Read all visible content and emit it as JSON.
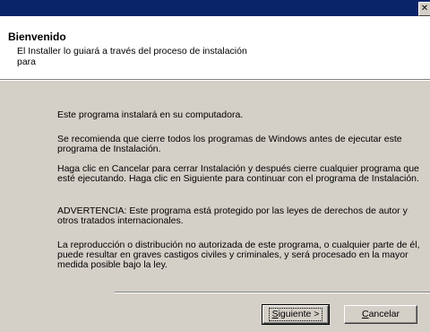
{
  "window": {
    "title": "",
    "close_glyph": "✕"
  },
  "header": {
    "title": "Bienvenido",
    "subtitle": "El Installer lo guiará a través del proceso de instalación para"
  },
  "content": {
    "paragraphs": [
      "Este programa instalará  en su computadora.",
      "Se recomienda que cierre todos los programas de Windows antes de ejecutar este programa de Instalación.",
      "Haga clic en Cancelar para cerrar Instalación y después cierre cualquier programa que esté ejecutando. Haga clic en Siguiente para continuar con el programa de Instalación.",
      "ADVERTENCIA: Este programa está protegido por las leyes de derechos de autor y otros tratados internacionales.",
      "La reproducción o distribución no autorizada de este programa, o cualquier parte de él, puede resultar en graves castigos civiles y criminales, y será procesado en la mayor medida posible bajo la ley."
    ]
  },
  "buttons": {
    "next": {
      "mnemonic": "S",
      "rest": "iguiente >"
    },
    "cancel": {
      "mnemonic": "C",
      "rest": "ancelar"
    }
  },
  "colors": {
    "titlebar": "#0a246a",
    "face": "#d4d0c8",
    "header_bg": "#ffffff"
  }
}
